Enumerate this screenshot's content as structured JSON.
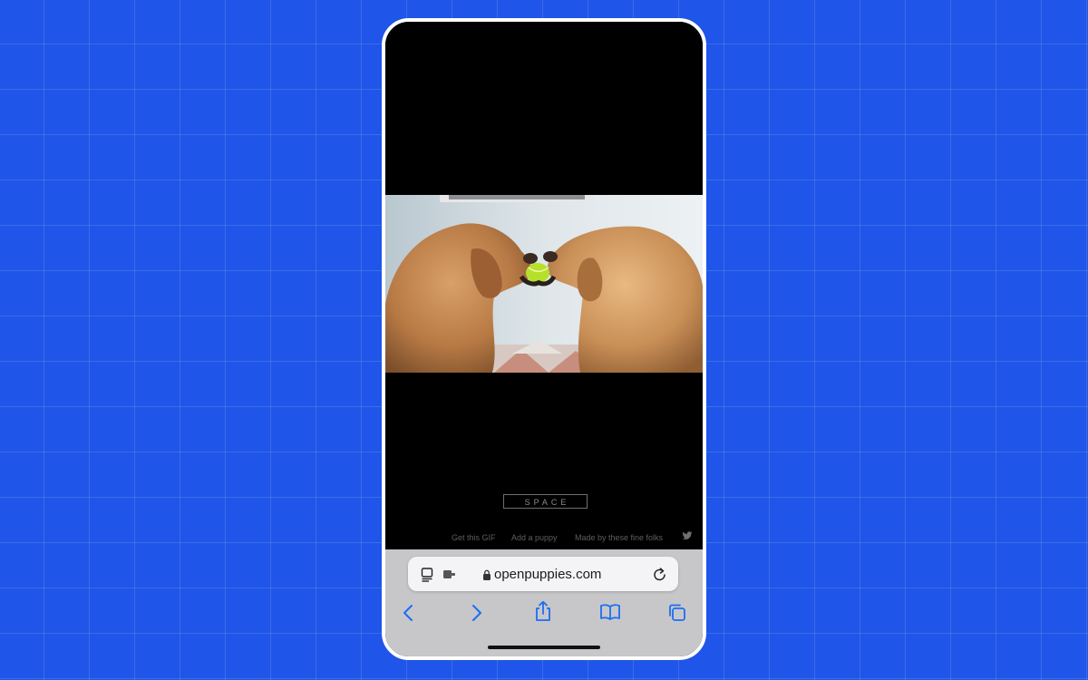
{
  "page": {
    "background_color": "#1f55e8",
    "space_button_label": "SPACE",
    "footer_links": [
      "Get this GIF",
      "Add a puppy",
      "Made by these fine folks"
    ],
    "footer_icon": "twitter-icon"
  },
  "browser": {
    "url": "openpuppies.com",
    "address_bar_icons": [
      "reader-mode-icon",
      "extension-icon",
      "lock-icon",
      "reload-icon"
    ],
    "toolbar_icons": [
      "back-icon",
      "forward-icon",
      "share-icon",
      "bookmarks-icon",
      "tabs-icon"
    ],
    "accent_color": "#1b6ef3"
  },
  "media": {
    "subject": "two golden retrievers holding a tennis ball"
  }
}
